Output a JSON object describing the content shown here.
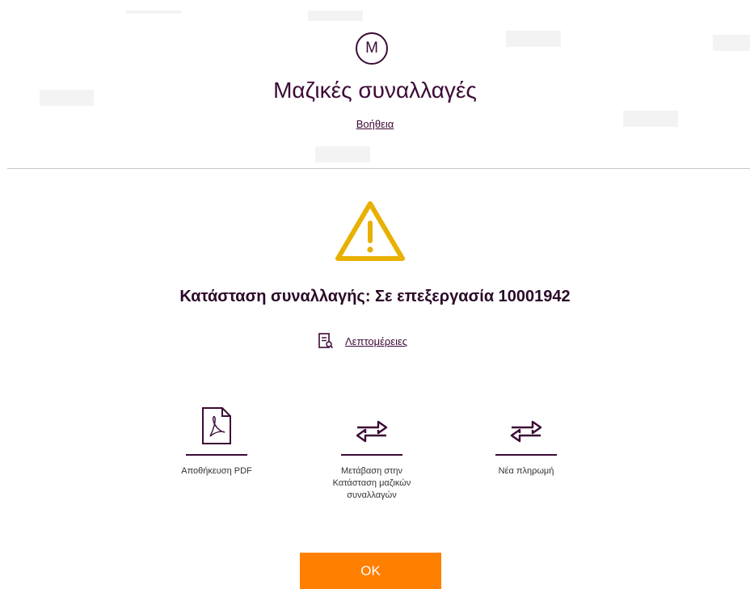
{
  "header": {
    "avatar_letter": "M",
    "title": "Μαζικές συναλλαγές",
    "help_link": "Βοήθεια"
  },
  "status": {
    "title": "Κατάσταση συναλλαγής: Σε επεξεργασία 10001942",
    "details_link": "Λεπτομέρειες"
  },
  "actions": [
    {
      "label": "Αποθήκευση PDF",
      "icon": "pdf-document-icon"
    },
    {
      "label": "Μετάβαση στην Κατάσταση μαζικών συναλλαγών",
      "icon": "swap-arrows-icon"
    },
    {
      "label": "Νέα πληρωμή",
      "icon": "swap-arrows-icon"
    }
  ],
  "ok_button": "OK",
  "colors": {
    "brand": "#3c0a36",
    "accent": "#ff7f00",
    "warning": "#e8b000",
    "divider": "#c8c8c8"
  }
}
